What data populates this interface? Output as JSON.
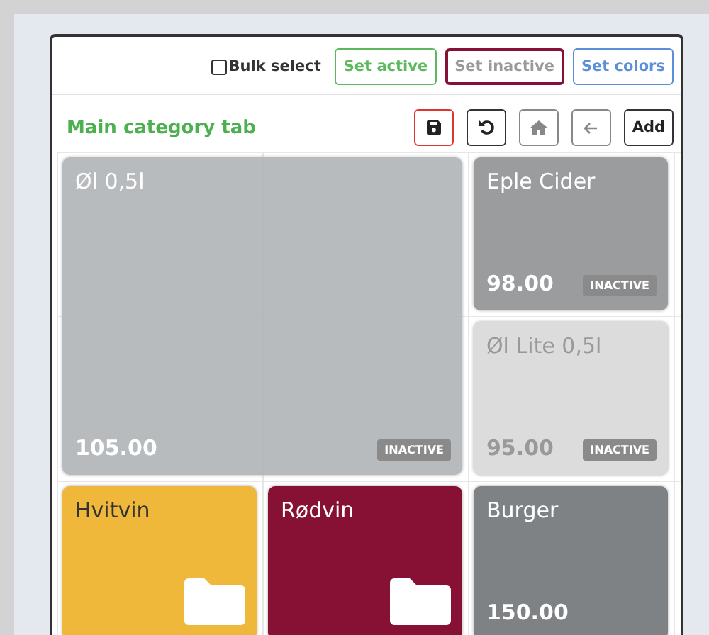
{
  "toolbar": {
    "bulk_select": {
      "label": "Bulk select",
      "checked": false
    },
    "actions": [
      {
        "label": "Set active",
        "color": "#5cb85c",
        "selected": false
      },
      {
        "label": "Set inactive",
        "color": "#9a9a9a",
        "selected": true
      },
      {
        "label": "Set colors",
        "color": "#5b8fd9",
        "selected": false
      }
    ]
  },
  "header": {
    "title": "Main category tab",
    "tools": [
      {
        "kind": "save"
      },
      {
        "kind": "undo"
      },
      {
        "kind": "home"
      },
      {
        "kind": "back"
      },
      {
        "kind": "add",
        "label": "Add"
      }
    ]
  },
  "tiles": [
    {
      "kind": "product",
      "name": "Øl 0,5l",
      "price": "105.00",
      "badge": "INACTIVE",
      "color": "#b1b4b6"
    },
    {
      "kind": "product",
      "name": "Eple Cider",
      "price": "98.00",
      "badge": "INACTIVE",
      "color": "#9a9c9e"
    },
    {
      "kind": "product",
      "name": "Øl Lite 0,5l",
      "price": "95.00",
      "badge": "INACTIVE",
      "color": "#dcdcdc"
    },
    {
      "kind": "folder",
      "name": "Hvitvin",
      "color": "#f0b83a"
    },
    {
      "kind": "folder",
      "name": "Rødvin",
      "color": "#861134"
    },
    {
      "kind": "product",
      "name": "Burger",
      "price": "150.00",
      "color": "#7f8285"
    }
  ]
}
